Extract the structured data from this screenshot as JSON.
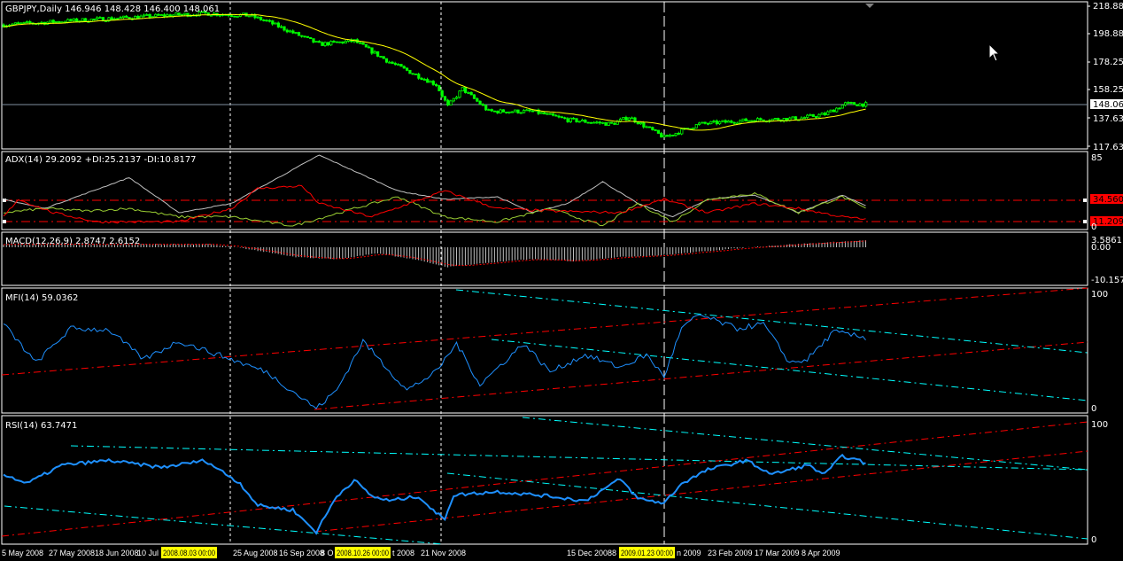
{
  "main": {
    "title": "GBPJPY,Daily  146.946 148.428 146.400 148.061",
    "price_ticks": [
      "218.880",
      "198.880",
      "178.255",
      "158.255",
      "137.630",
      "117.630"
    ],
    "current_price": "148.061",
    "close_keypoints": [
      [
        0,
        204.4
      ],
      [
        29,
        208
      ],
      [
        69,
        212.6
      ],
      [
        84,
        211
      ],
      [
        90,
        207
      ],
      [
        108,
        190.6
      ],
      [
        120,
        193
      ],
      [
        132,
        178
      ],
      [
        148,
        162
      ],
      [
        152,
        146.5
      ],
      [
        157,
        159
      ],
      [
        166,
        143
      ],
      [
        181,
        143
      ],
      [
        193,
        137
      ],
      [
        208,
        134
      ],
      [
        214,
        139
      ],
      [
        226,
        124.5
      ],
      [
        238,
        134
      ],
      [
        257,
        137
      ],
      [
        272,
        138
      ],
      [
        281,
        141
      ],
      [
        288,
        148.4
      ],
      [
        295,
        148
      ]
    ],
    "price_range": [
      117.63,
      218.88
    ]
  },
  "adx": {
    "title": "ADX(14) 29.2092 +DI:25.2137 -DI:10.8177",
    "max_label": "85",
    "min_label": "0",
    "level_high": "34.560",
    "level_low": "11.209",
    "adx": [
      [
        0,
        32
      ],
      [
        14,
        21
      ],
      [
        43,
        58
      ],
      [
        60,
        16
      ],
      [
        78,
        27
      ],
      [
        108,
        85
      ],
      [
        135,
        42
      ],
      [
        151,
        32
      ],
      [
        169,
        35
      ],
      [
        181,
        16
      ],
      [
        193,
        27
      ],
      [
        205,
        53
      ],
      [
        217,
        27
      ],
      [
        229,
        11
      ],
      [
        241,
        32
      ],
      [
        257,
        37
      ],
      [
        272,
        16
      ],
      [
        287,
        37
      ],
      [
        295,
        24
      ]
    ],
    "plus_di": [
      [
        0,
        16
      ],
      [
        14,
        21
      ],
      [
        29,
        18
      ],
      [
        43,
        21
      ],
      [
        60,
        11
      ],
      [
        78,
        11
      ],
      [
        99,
        0
      ],
      [
        120,
        21
      ],
      [
        135,
        35
      ],
      [
        151,
        11
      ],
      [
        169,
        5
      ],
      [
        187,
        21
      ],
      [
        205,
        0
      ],
      [
        217,
        27
      ],
      [
        229,
        5
      ],
      [
        241,
        32
      ],
      [
        257,
        39
      ],
      [
        272,
        16
      ],
      [
        287,
        35
      ],
      [
        295,
        21
      ]
    ],
    "minus_di": [
      [
        0,
        11
      ],
      [
        5,
        32
      ],
      [
        17,
        16
      ],
      [
        32,
        5
      ],
      [
        60,
        5
      ],
      [
        78,
        21
      ],
      [
        87,
        45
      ],
      [
        102,
        48
      ],
      [
        108,
        27
      ],
      [
        126,
        11
      ],
      [
        151,
        42
      ],
      [
        169,
        21
      ],
      [
        187,
        18
      ],
      [
        211,
        16
      ],
      [
        226,
        32
      ],
      [
        241,
        16
      ],
      [
        257,
        27
      ],
      [
        272,
        21
      ],
      [
        287,
        11
      ],
      [
        295,
        8
      ]
    ]
  },
  "macd": {
    "title": "MACD(12,26,9) 2.8747 2.6152",
    "ticks": [
      "3.5861",
      "0.00",
      "-10.1572"
    ],
    "hist": [
      [
        0,
        1.5
      ],
      [
        70,
        1.5
      ],
      [
        80,
        0
      ],
      [
        100,
        -5
      ],
      [
        115,
        -6
      ],
      [
        128,
        -3
      ],
      [
        140,
        -6
      ],
      [
        152,
        -10
      ],
      [
        165,
        -8
      ],
      [
        180,
        -6
      ],
      [
        195,
        -7
      ],
      [
        210,
        -5
      ],
      [
        226,
        -4
      ],
      [
        240,
        -2
      ],
      [
        255,
        0
      ],
      [
        270,
        1.5
      ],
      [
        295,
        3.5
      ]
    ]
  },
  "mfi": {
    "title": "MFI(14) 59.0362",
    "max_label": "100",
    "min_label": "0",
    "values": [
      [
        0,
        74
      ],
      [
        11,
        40
      ],
      [
        23,
        70
      ],
      [
        36,
        69
      ],
      [
        48,
        43
      ],
      [
        60,
        59
      ],
      [
        78,
        43
      ],
      [
        90,
        32
      ],
      [
        107,
        0
      ],
      [
        114,
        16
      ],
      [
        123,
        59
      ],
      [
        138,
        16
      ],
      [
        148,
        32
      ],
      [
        155,
        57
      ],
      [
        163,
        21
      ],
      [
        178,
        57
      ],
      [
        187,
        32
      ],
      [
        199,
        47
      ],
      [
        211,
        36
      ],
      [
        220,
        47
      ],
      [
        226,
        28
      ],
      [
        232,
        70
      ],
      [
        238,
        82
      ],
      [
        251,
        70
      ],
      [
        260,
        74
      ],
      [
        269,
        40
      ],
      [
        275,
        43
      ],
      [
        284,
        67
      ],
      [
        295,
        62
      ]
    ]
  },
  "rsi": {
    "title": "RSI(14) 63.7471",
    "max_label": "100",
    "min_label": "0",
    "values": [
      [
        0,
        56
      ],
      [
        8,
        48
      ],
      [
        20,
        64
      ],
      [
        36,
        68
      ],
      [
        54,
        62
      ],
      [
        69,
        68
      ],
      [
        81,
        48
      ],
      [
        87,
        29
      ],
      [
        99,
        25
      ],
      [
        107,
        6
      ],
      [
        114,
        37
      ],
      [
        120,
        51
      ],
      [
        126,
        37
      ],
      [
        132,
        33
      ],
      [
        142,
        37
      ],
      [
        148,
        22
      ],
      [
        151,
        18
      ],
      [
        154,
        38
      ],
      [
        169,
        41
      ],
      [
        187,
        37
      ],
      [
        199,
        33
      ],
      [
        211,
        52
      ],
      [
        217,
        35
      ],
      [
        226,
        31
      ],
      [
        232,
        48
      ],
      [
        241,
        60
      ],
      [
        254,
        68
      ],
      [
        263,
        56
      ],
      [
        275,
        64
      ],
      [
        281,
        56
      ],
      [
        287,
        72
      ],
      [
        295,
        66
      ]
    ]
  },
  "time_axis": {
    "labels": [
      "5 May 2008",
      "27 May 2008",
      "18 Jun 2008",
      "10 Jul",
      "25 Aug 2008",
      "16 Sep 2008",
      "8 O",
      "t 2008",
      "21 Nov 2008",
      "15 Dec 2008",
      "8",
      "n 2009",
      "23 Feb 2009",
      "17 Mar 2009",
      "8 Apr 2009"
    ],
    "crosshairs": [
      "2008.08.03 00:00",
      "2008.10.26 00:00",
      "2009.01.23 00:00"
    ]
  },
  "colors": {
    "bull": "#00ff00",
    "ma": "#ffff00",
    "adx": "#c0c0c0",
    "plus_di": "#9acd32",
    "minus_di": "#ff0000",
    "mfi": "#1e90ff",
    "trend_red": "#ff0000",
    "trend_cyan": "#00ffff"
  }
}
